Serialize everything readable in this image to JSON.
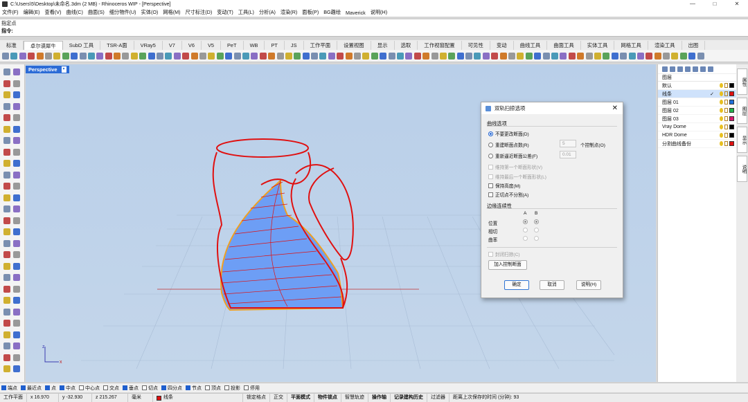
{
  "window": {
    "title": "C:\\Users\\5\\Desktop\\未命名.3dm (2 MB) - Rhinoceros WIP - [Perspective]",
    "controls": [
      "—",
      "□",
      "✕"
    ]
  },
  "menu": [
    "文件(F)",
    "编辑(E)",
    "查看(V)",
    "曲线(C)",
    "曲面(S)",
    "细分物件(U)",
    "实体(O)",
    "网格(M)",
    "尺寸标注(D)",
    "变动(T)",
    "工具(L)",
    "分析(A)",
    "渲染(R)",
    "面板(P)",
    "BG趣绘",
    "Maverick",
    "说明(H)"
  ],
  "command": {
    "history": "指定点",
    "prompt": "指令:"
  },
  "tabs": [
    "标准",
    "卓尔谟犀牛",
    "SubD 工具",
    "TSR-A面",
    "VRay5",
    "V7",
    "V6",
    "V5",
    "PeT",
    "WB",
    "PT",
    "JS",
    "工作平面",
    "设置视图",
    "显示",
    "选取",
    "工作视窗配置",
    "可见性",
    "变动",
    "曲线工具",
    "曲面工具",
    "实体工具",
    "网格工具",
    "渲染工具",
    "出图"
  ],
  "active_tab_index": 1,
  "viewport": {
    "label": "Perspective",
    "axis": {
      "x": "x",
      "z": "z"
    }
  },
  "dialog": {
    "title": "双轨扫掠选项",
    "section_curve": "曲线选项",
    "opt_no_change": "不要更改断面(D)",
    "opt_rebuild": "重建断面点数(R)",
    "rebuild_value": "5",
    "rebuild_unit": "个控制点(O)",
    "opt_refit": "重新逼近断面公差(F)",
    "refit_value": "0.01",
    "opt_keep_first": "维持第一个断面形状(V)",
    "opt_keep_last": "维持最后一个断面形状(L)",
    "opt_keep_height": "保持高度(M)",
    "opt_no_split": "正切点不分割(A)",
    "section_edge": "边缘连续性",
    "col_a": "A",
    "col_b": "B",
    "row_position": "位置",
    "row_tangent": "相切",
    "row_curvature": "曲率",
    "opt_closed": "封闭扫掠(C)",
    "add_section_btn": "加入控制断面",
    "ok_btn": "确定",
    "cancel_btn": "取消",
    "help_btn": "说明(H)"
  },
  "layers": {
    "header": "图层",
    "items": [
      {
        "name": "默认",
        "color": "#000000"
      },
      {
        "name": "线条",
        "color": "#e01010",
        "selected": true
      },
      {
        "name": "图层 01",
        "color": "#1e6fd9"
      },
      {
        "name": "图层 02",
        "color": "#22b24c"
      },
      {
        "name": "图层 03",
        "color": "#d6186e"
      },
      {
        "name": "Vray Dome",
        "color": "#000000"
      },
      {
        "name": "HDR Dome",
        "color": "#000000"
      },
      {
        "name": "分割曲线备份",
        "color": "#e01010"
      }
    ]
  },
  "side_tabs": [
    "属性",
    "图层",
    "显示",
    "说明"
  ],
  "osnaps": [
    {
      "label": "端点",
      "on": true
    },
    {
      "label": "最近点",
      "on": true
    },
    {
      "label": "点",
      "on": true
    },
    {
      "label": "中点",
      "on": true
    },
    {
      "label": "中心点",
      "on": false
    },
    {
      "label": "交点",
      "on": false
    },
    {
      "label": "垂点",
      "on": true
    },
    {
      "label": "切点",
      "on": false
    },
    {
      "label": "四分点",
      "on": true
    },
    {
      "label": "节点",
      "on": true
    },
    {
      "label": "顶点",
      "on": false
    },
    {
      "label": "投影",
      "on": false
    },
    {
      "label": "停用",
      "on": false
    }
  ],
  "status": {
    "cplane": "工作平面",
    "x": "x 16.970",
    "y": "y -32.930",
    "z": "z 215.267",
    "unit": "毫米",
    "layer": "线条",
    "layer_color": "#e01010",
    "buttons": [
      "锁定格点",
      "正交",
      "平面模式",
      "物件锁点",
      "智慧轨迹",
      "操作轴",
      "记录建构历史",
      "过滤器"
    ],
    "bold_buttons": [
      "平面模式",
      "物件锁点",
      "操作轴",
      "记录建构历史"
    ],
    "info": "距离上次保存的时间 (分钟): 93"
  },
  "colors": {
    "curve": "#e01010",
    "surface": "#6d9ef5",
    "edge_highlight": "#f0a020",
    "viewport_bg": "#bed3ea"
  }
}
